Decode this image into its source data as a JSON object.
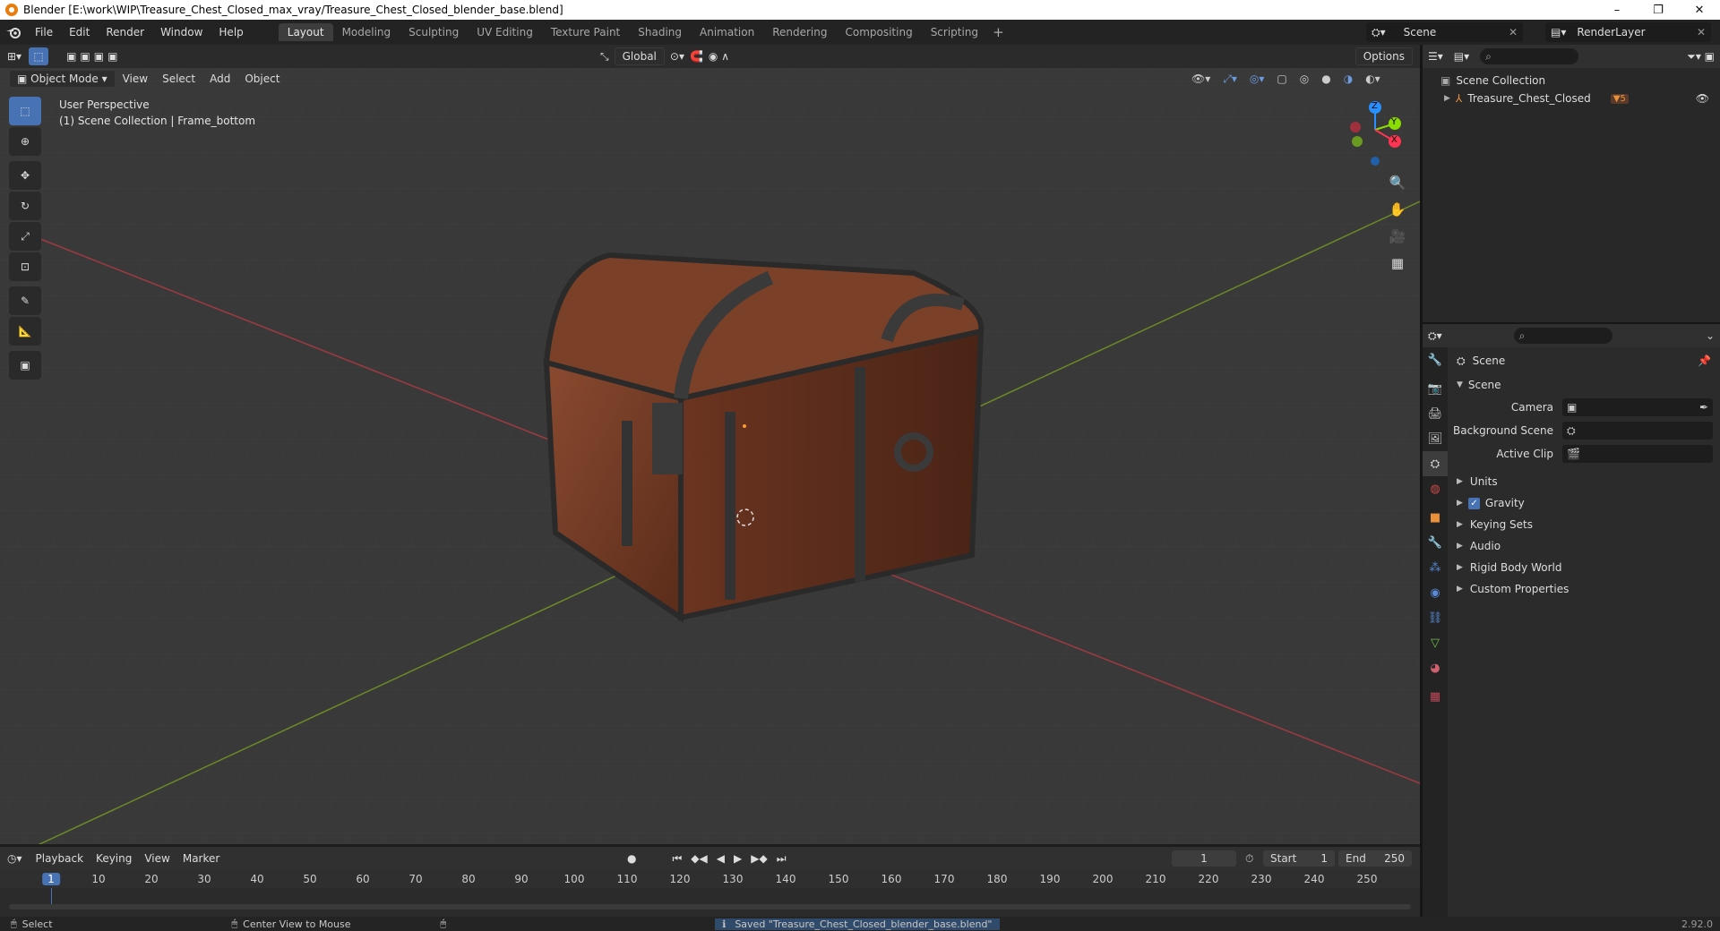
{
  "window": {
    "title": "Blender [E:\\work\\WIP\\Treasure_Chest_Closed_max_vray/Treasure_Chest_Closed_blender_base.blend]",
    "min": "–",
    "restore": "❐",
    "close": "✕"
  },
  "menus": [
    "File",
    "Edit",
    "Render",
    "Window",
    "Help"
  ],
  "workspaces": [
    "Layout",
    "Modeling",
    "Sculpting",
    "UV Editing",
    "Texture Paint",
    "Shading",
    "Animation",
    "Rendering",
    "Compositing",
    "Scripting"
  ],
  "active_workspace": "Layout",
  "scene_name": "Scene",
  "render_layer": "RenderLayer",
  "tool_header": {
    "orientation": "Global",
    "options": "Options"
  },
  "viewport_header": {
    "mode": "Object Mode",
    "items": [
      "View",
      "Select",
      "Add",
      "Object"
    ]
  },
  "viewport_overlay": {
    "line1": "User Perspective",
    "line2": "(1) Scene Collection | Frame_bottom"
  },
  "gizmo": {
    "x": "X",
    "y": "Y",
    "z": "Z"
  },
  "outliner": {
    "root": "Scene Collection",
    "child": "Treasure_Chest_Closed",
    "child_badge": "5"
  },
  "properties": {
    "context_name": "Scene",
    "panel_title": "Scene",
    "fields": [
      {
        "label": "Camera",
        "value": ""
      },
      {
        "label": "Background Scene",
        "value": ""
      },
      {
        "label": "Active Clip",
        "value": ""
      }
    ],
    "sections": [
      "Units",
      "Gravity",
      "Keying Sets",
      "Audio",
      "Rigid Body World",
      "Custom Properties"
    ],
    "gravity_checked": true
  },
  "timeline": {
    "menus": [
      "Playback",
      "Keying",
      "View",
      "Marker"
    ],
    "current_frame": "1",
    "start_label": "Start",
    "start": "1",
    "end_label": "End",
    "end": "250",
    "ticks": [
      "1",
      "10",
      "20",
      "30",
      "40",
      "50",
      "60",
      "70",
      "80",
      "90",
      "100",
      "110",
      "120",
      "130",
      "140",
      "150",
      "160",
      "170",
      "180",
      "190",
      "200",
      "210",
      "220",
      "230",
      "240",
      "250"
    ]
  },
  "statusbar": {
    "left": "Select",
    "middle": "Center View to Mouse",
    "message": "Saved \"Treasure_Chest_Closed_blender_base.blend\"",
    "version": "2.92.0"
  },
  "colors": {
    "accent": "#4772b3",
    "axis_x": "#ff3352",
    "axis_y": "#8bdc00",
    "axis_z": "#2890ff"
  }
}
